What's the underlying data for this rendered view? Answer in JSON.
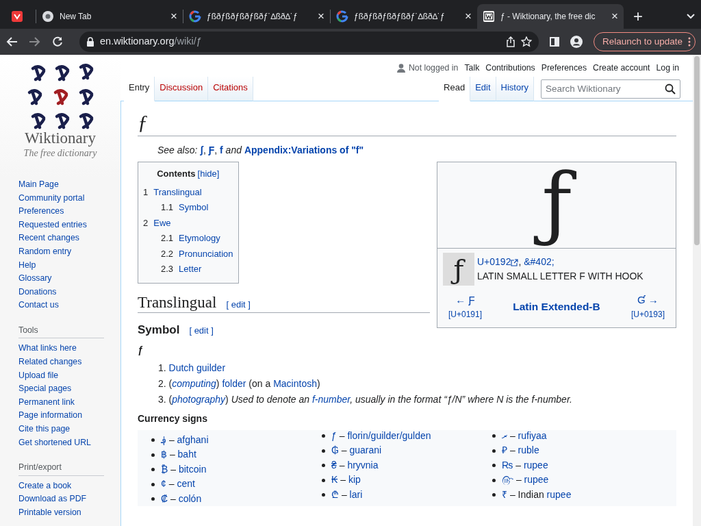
{
  "browser": {
    "tabs": [
      {
        "selected": false
      },
      {
        "title": "New Tab",
        "close": "×",
        "selected": false
      },
      {
        "title": "ƒßðƒßðƒßðƒßðƒ˙∆ßð∆˙ƒ",
        "close": "×",
        "selected": false
      },
      {
        "title": "ƒßðƒßðƒßðƒßðƒ˙∆ßð∆˙ƒ",
        "close": "×",
        "selected": false
      },
      {
        "title": "ƒ - Wiktionary, the free dic",
        "close": "×",
        "selected": true
      }
    ],
    "new_tab": "+",
    "address": {
      "host": "en.wiktionary.org",
      "path": "/wiki/ƒ"
    },
    "relaunch": "Relaunch to update"
  },
  "sidebar": {
    "logo": {
      "name": "Wiktionary",
      "tagline": "The free dictionary"
    },
    "sections": [
      {
        "items": [
          "Main Page",
          "Community portal",
          "Preferences",
          "Requested entries",
          "Recent changes",
          "Random entry",
          "Help",
          "Glossary",
          "Donations",
          "Contact us"
        ]
      },
      {
        "heading": "Tools",
        "items": [
          "What links here",
          "Related changes",
          "Upload file",
          "Special pages",
          "Permanent link",
          "Page information",
          "Cite this page",
          "Get shortened URL"
        ]
      },
      {
        "heading": "Print/export",
        "items": [
          "Create a book",
          "Download as PDF",
          "Printable version"
        ]
      }
    ]
  },
  "personal": {
    "status": "Not logged in",
    "links": [
      "Talk",
      "Contributions",
      "Preferences",
      "Create account",
      "Log in"
    ]
  },
  "left_tabs": [
    {
      "label": "Entry",
      "selected": true,
      "exists": true
    },
    {
      "label": "Discussion",
      "selected": false,
      "exists": false
    },
    {
      "label": "Citations",
      "selected": false,
      "exists": false
    }
  ],
  "right_tabs": [
    {
      "label": "Read",
      "selected": true
    },
    {
      "label": "Edit",
      "selected": false
    },
    {
      "label": "History",
      "selected": false
    }
  ],
  "search": {
    "placeholder": "Search Wiktionary"
  },
  "title": "ƒ",
  "see_also": [
    {
      "em": "See also: "
    },
    {
      "link": "ʃ"
    },
    ", ",
    {
      "link": "Ƒ"
    },
    ", ",
    {
      "link": "f"
    },
    {
      "em": " and "
    },
    {
      "link": "Appendix:Variations of \"f\""
    }
  ],
  "toc": {
    "title": "Contents",
    "toggle": "[hide]",
    "items": [
      {
        "number": "1",
        "label": "Translingual",
        "children": [
          {
            "number": "1.1",
            "label": "Symbol"
          }
        ]
      },
      {
        "number": "2",
        "label": "Ewe",
        "children": [
          {
            "number": "2.1",
            "label": "Etymology"
          },
          {
            "number": "2.2",
            "label": "Pronunciation"
          },
          {
            "number": "2.3",
            "label": "Letter"
          }
        ]
      }
    ]
  },
  "infobox": {
    "glyph": "ƒ",
    "small_glyph": "ƒ",
    "codepoint": "U+0192",
    "separator": ", ",
    "entity": "&#402;",
    "char_name": "LATIN SMALL LETTER F WITH HOOK",
    "prev": {
      "char": "← Ƒ",
      "code": "[U+0191]"
    },
    "block": "Latin Extended-B",
    "next": {
      "char": "Ɠ →",
      "code": "[U+0193]"
    }
  },
  "sections": [
    {
      "heading": "Translingual",
      "edit": "[ edit ]"
    }
  ],
  "symbol": {
    "heading": "Symbol",
    "edit": "[ edit ]",
    "headword": "ƒ",
    "definitions": [
      {
        "number": "1.",
        "segments": [
          {
            "link": "Dutch guilder"
          }
        ]
      },
      {
        "number": "2.",
        "segments": [
          "(",
          {
            "em_link": "computing"
          },
          ") ",
          {
            "link": "folder"
          },
          " (on a ",
          {
            "link": "Macintosh"
          },
          ")"
        ]
      },
      {
        "number": "3.",
        "segments": [
          "(",
          {
            "em_link": "photography"
          },
          ") ",
          {
            "em": "Used to denote an "
          },
          {
            "em_link": "f-number"
          },
          {
            "em": ", usually in the format “ƒ/N” where N is the f-number."
          }
        ]
      }
    ]
  },
  "currency": {
    "heading": "Currency signs",
    "columns": [
      [
        [
          {
            "link": "؋"
          },
          " – ",
          {
            "link": "afghani"
          }
        ],
        [
          {
            "link": "฿"
          },
          " – ",
          {
            "link": "baht"
          }
        ],
        [
          {
            "link": "₿"
          },
          " – ",
          {
            "link": "bitcoin"
          }
        ],
        [
          {
            "link": "¢"
          },
          " – ",
          {
            "link": "cent"
          }
        ],
        [
          {
            "link": "₡"
          },
          " – ",
          {
            "link": "colón"
          }
        ]
      ],
      [
        [
          {
            "link": "ƒ"
          },
          " – ",
          {
            "link": "florin/guilder/gulden"
          }
        ],
        [
          {
            "link": "₲"
          },
          " – ",
          {
            "link": "guarani"
          }
        ],
        [
          {
            "link": "₴"
          },
          " – ",
          {
            "link": "hryvnia"
          }
        ],
        [
          {
            "link": "₭"
          },
          " – ",
          {
            "link": "kip"
          }
        ],
        [
          {
            "link": "₾"
          },
          " – ",
          {
            "link": "lari"
          }
        ]
      ],
      [
        [
          {
            "link": "ރ"
          },
          " – ",
          {
            "link": "rufiyaa"
          }
        ],
        [
          {
            "link": "₽"
          },
          " – ",
          {
            "link": "ruble"
          }
        ],
        [
          {
            "link": "₨"
          },
          " – ",
          {
            "link": "rupee"
          }
        ],
        [
          {
            "link": "௹"
          },
          " – ",
          {
            "link": "rupee"
          }
        ],
        [
          {
            "link": "₹"
          },
          " – Indian ",
          {
            "link": "rupee"
          }
        ]
      ]
    ]
  }
}
